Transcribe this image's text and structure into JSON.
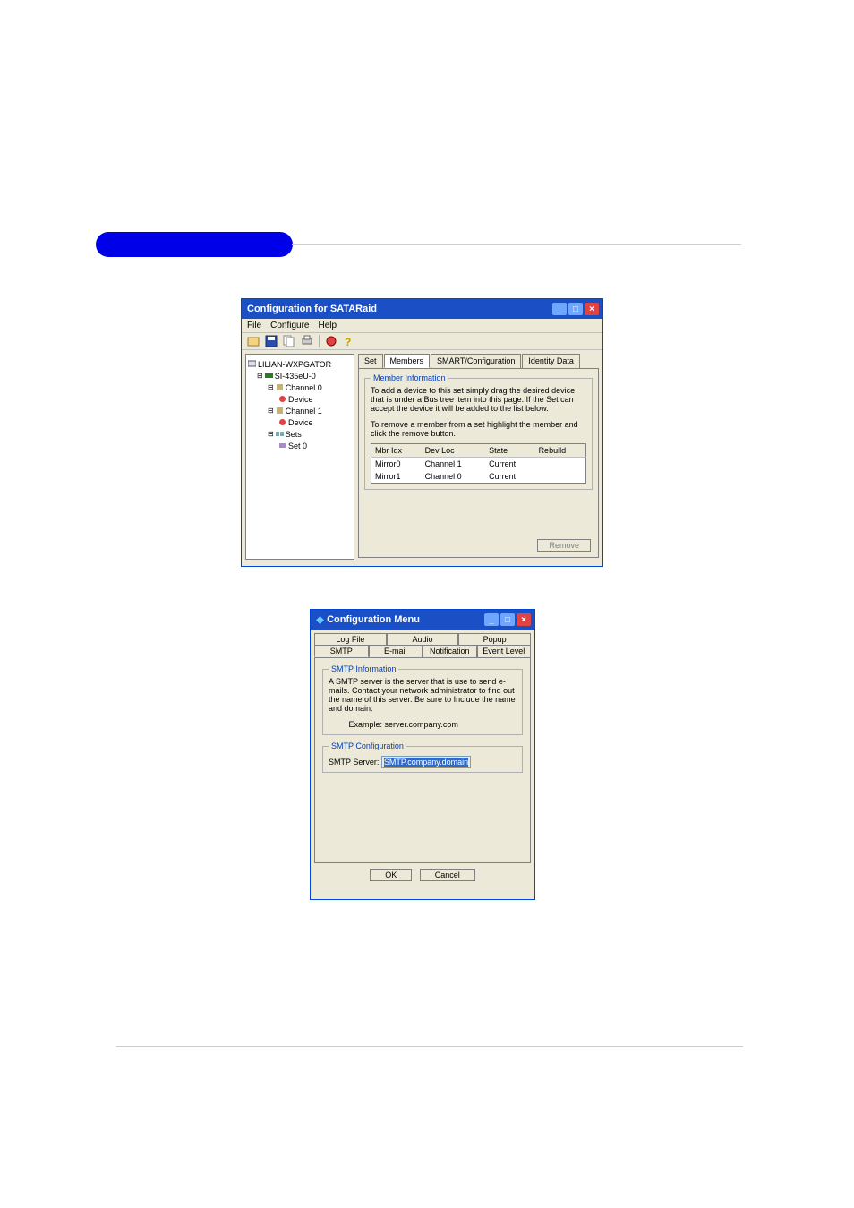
{
  "win1": {
    "title": "Configuration for SATARaid",
    "menu": {
      "file": "File",
      "configure": "Configure",
      "help": "Help"
    },
    "tree": {
      "root": "LILIAN-WXPGATOR",
      "adapter": "SI-435eU-0",
      "ch0": "Channel 0",
      "dev0": "Device",
      "ch1": "Channel 1",
      "dev1": "Device",
      "sets": "Sets",
      "set0": "Set 0"
    },
    "tabs": {
      "set": "Set",
      "members": "Members",
      "smart": "SMART/Configuration",
      "identity": "Identity Data"
    },
    "member_info": {
      "legend": "Member Information",
      "line1": "To add a device to this set simply drag the desired device that is under a Bus tree item into this page.  If the Set can accept the device it will be added to the list below.",
      "line2": "To remove a member from a set highlight the member and click the remove button."
    },
    "table": {
      "headers": {
        "idx": "Mbr Idx",
        "loc": "Dev Loc",
        "state": "State",
        "rebuild": "Rebuild"
      },
      "rows": [
        {
          "idx": "Mirror0",
          "loc": "Channel  1",
          "state": "Current",
          "rebuild": ""
        },
        {
          "idx": "Mirror1",
          "loc": "Channel  0",
          "state": "Current",
          "rebuild": ""
        }
      ]
    },
    "remove": "Remove"
  },
  "win2": {
    "title": "Configuration Menu",
    "tabs_row1": {
      "log": "Log File",
      "audio": "Audio",
      "popup": "Popup"
    },
    "tabs_row2": {
      "smtp": "SMTP",
      "email": "E-mail",
      "notif": "Notification",
      "evt": "Event Level"
    },
    "smtp_info": {
      "legend": "SMTP Information",
      "text": "A SMTP server is the server that is use to send e-mails. Contact your network administrator to find out the name of this server. Be sure to Include the name and domain.",
      "example_label": "Example:",
      "example_value": "server.company.com"
    },
    "smtp_conf": {
      "legend": "SMTP Configuration",
      "label": "SMTP Server:",
      "value": "SMTP.company.domain"
    },
    "buttons": {
      "ok": "OK",
      "cancel": "Cancel"
    }
  }
}
